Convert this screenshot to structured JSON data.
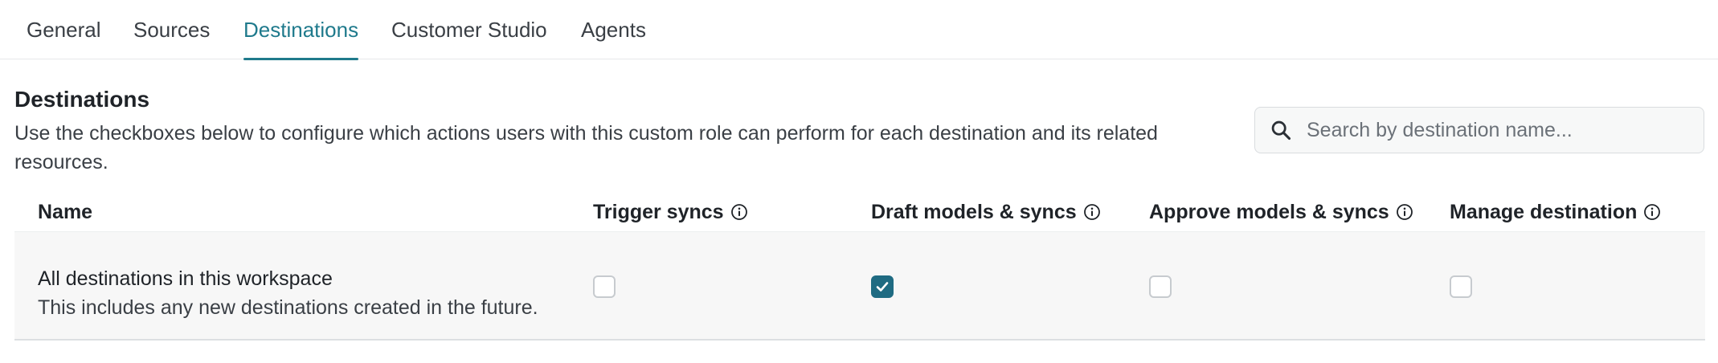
{
  "tabs": [
    {
      "label": "General",
      "active": false
    },
    {
      "label": "Sources",
      "active": false
    },
    {
      "label": "Destinations",
      "active": true
    },
    {
      "label": "Customer Studio",
      "active": false
    },
    {
      "label": "Agents",
      "active": false
    }
  ],
  "section": {
    "title": "Destinations",
    "description": "Use the checkboxes below to configure which actions users with this custom role can perform for each destination and its related resources."
  },
  "search": {
    "icon": "search-icon",
    "placeholder": "Search by destination name...",
    "value": ""
  },
  "table": {
    "columns": [
      {
        "label": "Name",
        "info_icon": false
      },
      {
        "label": "Trigger syncs",
        "info_icon": true
      },
      {
        "label": "Draft models & syncs",
        "info_icon": true
      },
      {
        "label": "Approve models & syncs",
        "info_icon": true
      },
      {
        "label": "Manage destination",
        "info_icon": true
      }
    ],
    "rows": [
      {
        "title": "All destinations in this workspace",
        "subtitle": "This includes any new destinations created in the future.",
        "trigger_syncs": false,
        "draft_models_syncs": true,
        "approve_models_syncs": false,
        "manage_destination": false
      }
    ]
  },
  "colors": {
    "accent": "#1f7a8c",
    "checkbox_checked": "#1f6b82",
    "row_background": "#f7f7f7"
  }
}
